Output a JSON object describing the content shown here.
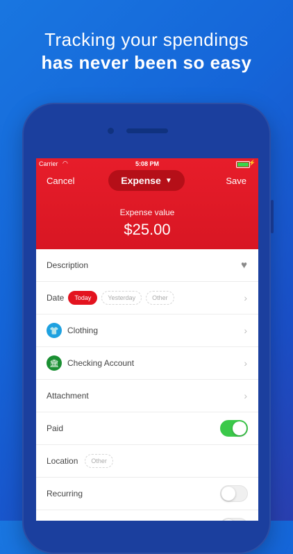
{
  "headline": {
    "line1": "Tracking your spendings",
    "line2": "has never been so easy"
  },
  "status": {
    "carrier": "Carrier",
    "time": "5:08 PM"
  },
  "nav": {
    "cancel": "Cancel",
    "type": "Expense",
    "save": "Save"
  },
  "amount": {
    "label": "Expense value",
    "value": "$25.00"
  },
  "rows": {
    "description": "Description",
    "date": "Date",
    "date_chips": [
      "Today",
      "Yesterday",
      "Other"
    ],
    "category": "Clothing",
    "account": "Checking Account",
    "attachment": "Attachment",
    "paid": "Paid",
    "location": "Location",
    "location_chip": "Other",
    "recurring": "Recurring"
  },
  "toggles": {
    "paid": true,
    "recurring": false
  },
  "colors": {
    "accent": "#e3131f",
    "toggle_on": "#3bc94a"
  },
  "icons": {
    "category": "tshirt-icon",
    "account": "bank-icon"
  }
}
